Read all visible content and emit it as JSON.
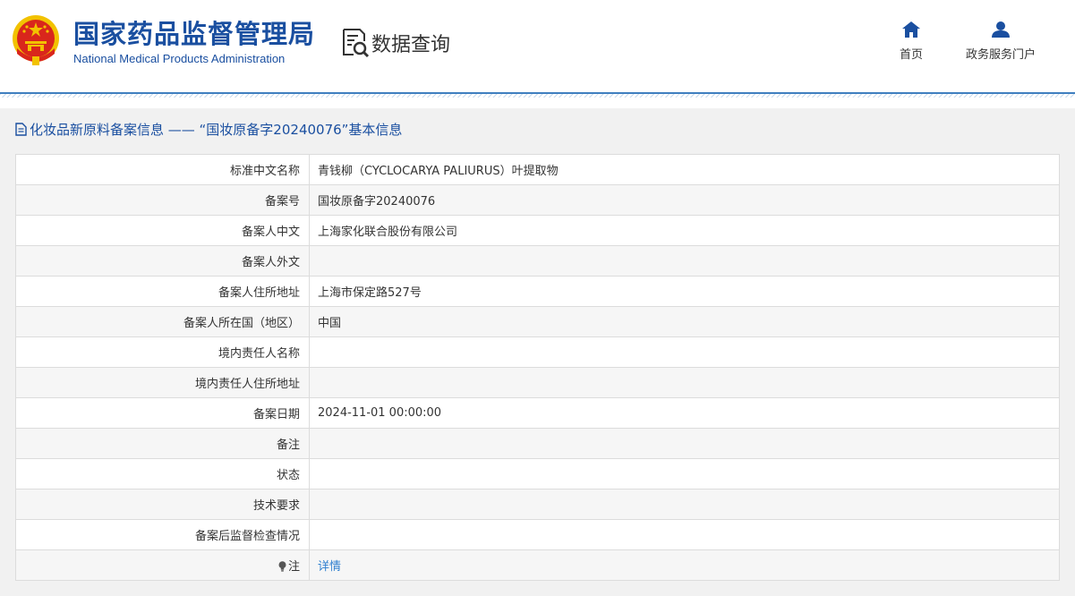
{
  "header": {
    "org_name_cn": "国家药品监督管理局",
    "org_name_en": "National Medical Products Administration",
    "query_label": "数据查询",
    "nav": {
      "home_label": "首页",
      "service_label": "政务服务门户"
    }
  },
  "panel": {
    "title": "化妆品新原料备案信息 —— “国妆原备字20240076”基本信息"
  },
  "rows": [
    {
      "label": "标准中文名称",
      "value": "青钱柳（CYCLOCARYA PALIURUS）叶提取物"
    },
    {
      "label": "备案号",
      "value": "国妆原备字20240076"
    },
    {
      "label": "备案人中文",
      "value": "上海家化联合股份有限公司"
    },
    {
      "label": "备案人外文",
      "value": ""
    },
    {
      "label": "备案人住所地址",
      "value": "上海市保定路527号"
    },
    {
      "label": "备案人所在国（地区）",
      "value": "中国"
    },
    {
      "label": "境内责任人名称",
      "value": ""
    },
    {
      "label": "境内责任人住所地址",
      "value": ""
    },
    {
      "label": "备案日期",
      "value": "2024-11-01 00:00:00"
    },
    {
      "label": "备注",
      "value": ""
    },
    {
      "label": "状态",
      "value": ""
    },
    {
      "label": "技术要求",
      "value": ""
    },
    {
      "label": "备案后监督检查情况",
      "value": ""
    }
  ],
  "note_row": {
    "label": "注",
    "link_label": "详情"
  },
  "colors": {
    "brand_blue": "#1a4fa0",
    "link_blue": "#2f7fcf",
    "emblem_red": "#d9261c",
    "emblem_gold": "#f2c200"
  },
  "icons": {
    "emblem": "national-emblem-icon",
    "query": "document-search-icon",
    "home": "home-icon",
    "service": "user-icon",
    "title": "document-icon",
    "note": "lightbulb-icon"
  }
}
